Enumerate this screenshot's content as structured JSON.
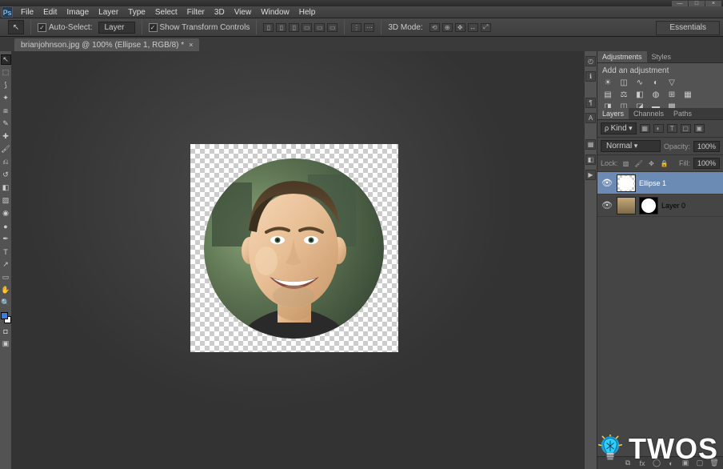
{
  "window": {
    "minimize": "—",
    "maximize": "□",
    "close": "×"
  },
  "app": {
    "logo": "Ps"
  },
  "menu": {
    "file": "File",
    "edit": "Edit",
    "image": "Image",
    "layer": "Layer",
    "type": "Type",
    "select": "Select",
    "filter": "Filter",
    "threeD": "3D",
    "view": "View",
    "window": "Window",
    "help": "Help"
  },
  "options": {
    "tool_icon": "↖",
    "auto_select_check": "✓",
    "auto_select_label": "Auto-Select:",
    "auto_select_value": "Layer",
    "show_transform_check": "✓",
    "show_transform_label": "Show Transform Controls",
    "threeD_mode": "3D Mode:"
  },
  "workspace": {
    "name": "Essentials"
  },
  "document": {
    "tab_title": "brianjohnson.jpg @ 100% (Ellipse 1, RGB/8) *",
    "tab_close": "×"
  },
  "panels": {
    "adjustments": {
      "tab_adjustments": "Adjustments",
      "tab_styles": "Styles",
      "heading": "Add an adjustment"
    },
    "layers": {
      "tab_layers": "Layers",
      "tab_channels": "Channels",
      "tab_paths": "Paths",
      "kind_value": "Kind",
      "blend_mode": "Normal",
      "opacity_label": "Opacity:",
      "opacity_value": "100%",
      "lock_label": "Lock:",
      "fill_label": "Fill:",
      "fill_value": "100%",
      "layers": [
        {
          "name": "Ellipse 1",
          "visible": true,
          "selected": true,
          "type": "shape"
        },
        {
          "name": "Layer 0",
          "visible": true,
          "selected": false,
          "type": "image_masked"
        }
      ]
    }
  },
  "watermark": {
    "text": "TWOS"
  }
}
